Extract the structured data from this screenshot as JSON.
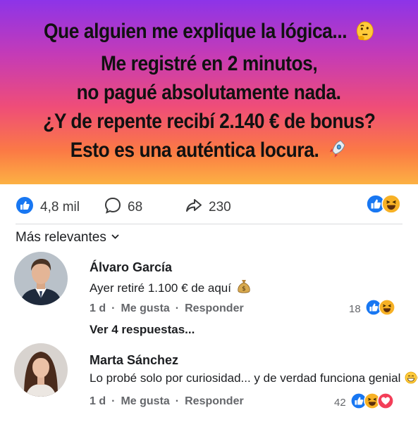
{
  "headline": {
    "line1": "Que alguien me explique la lógica...",
    "line2": "Me registré en 2 minutos,",
    "line3": "no pagué absolutamente nada.",
    "line4": "¿Y de repente recibí 2.140 € de bonus?",
    "line5": "Esto es una auténtica locura."
  },
  "stats": {
    "likes": "4,8 mil",
    "comments": "68",
    "shares": "230"
  },
  "sort_label": "Más relevantes",
  "comments": [
    {
      "name": "Álvaro García",
      "text": "Ayer retiré 1.100 € de aquí",
      "time": "1 d",
      "like_label": "Me gusta",
      "reply_label": "Responder",
      "reaction_count": "18",
      "replies_label": "Ver 4 respuestas..."
    },
    {
      "name": "Marta Sánchez",
      "text": "Lo probé solo por curiosidad... y de verdad funciona genial",
      "time": "1 d",
      "like_label": "Me gusta",
      "reply_label": "Responder",
      "reaction_count": "42"
    }
  ],
  "separator": "·",
  "colors": {
    "like_blue": "#1877f2",
    "haha_yellow": "#f7b125",
    "love_red": "#f33e58"
  },
  "icons": [
    "thinking-emoji-icon",
    "rocket-emoji-icon",
    "like-icon",
    "comment-icon",
    "share-icon",
    "haha-icon",
    "love-icon",
    "money-bag-icon",
    "grin-emoji-icon",
    "chevron-down-icon"
  ]
}
